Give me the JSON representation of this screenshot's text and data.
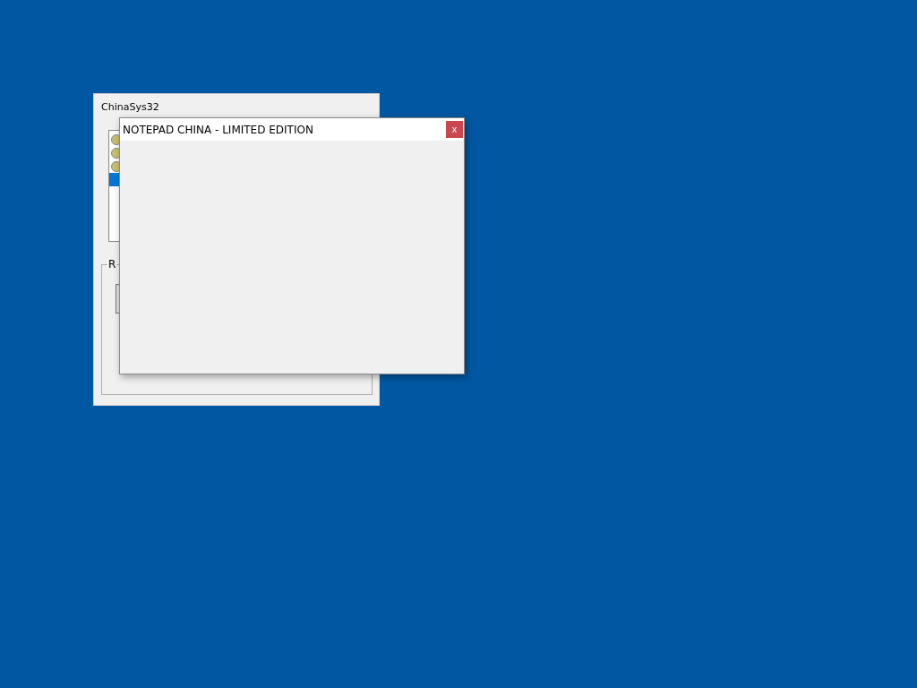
{
  "back_window": {
    "title": "ChinaSys32",
    "list_items": [
      {
        "selected": false
      },
      {
        "selected": false
      },
      {
        "selected": false
      },
      {
        "selected": true
      }
    ],
    "group_label": "R"
  },
  "front_window": {
    "title": "NOTEPAD CHINA - LIMITED EDITION",
    "close": "x"
  }
}
